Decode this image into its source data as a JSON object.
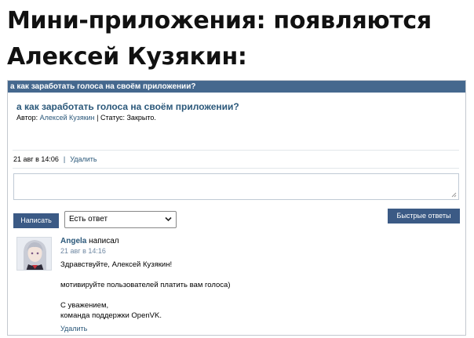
{
  "headline": {
    "line1": "Мини-приложения: появляются",
    "line2": "Алексей Кузякин:"
  },
  "panel": {
    "header": "а как заработать голоса на своём приложении?",
    "topic_title": "а как заработать голоса на своём приложении?",
    "author_label": "Автор:",
    "author_name": "Алексей Кузякин",
    "status_separator": "|",
    "status_label": "Статус:",
    "status_value": "Закрыто."
  },
  "topic_meta": {
    "date": "21 авг в 14:06",
    "separator": "|",
    "delete_label": "Удалить"
  },
  "reply_form": {
    "textarea_value": "",
    "post_button": "Написать",
    "select_value": "Есть ответ",
    "quick_answers_button": "Быстрые ответы"
  },
  "post": {
    "author": "Angela",
    "action": "написал",
    "date": "21 авг в 14:16",
    "lines": [
      "Здравствуйте, Алексей Кузякин!",
      "мотивируйте пользователей платить вам голоса)",
      "С уважением,",
      "команда поддержки OpenVK."
    ],
    "delete_label": "Удалить"
  },
  "colors": {
    "header_bg": "#45688e",
    "link": "#2b587a",
    "button_bg": "#3b5a85",
    "muted_date": "#6f88a3"
  },
  "icons": {
    "select_arrow": "chevron-down-icon",
    "textarea_grip": "resize-grip-icon",
    "avatar": "anime-avatar"
  }
}
